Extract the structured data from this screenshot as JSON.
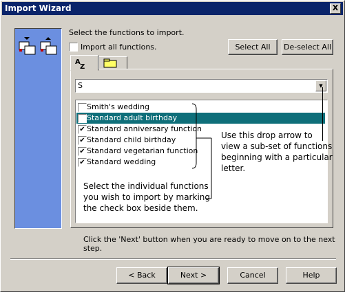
{
  "window": {
    "title": "Import Wizard",
    "close_glyph": "X"
  },
  "instruction": "Select the functions to import.",
  "import_all": {
    "label": "Import all functions.",
    "checked": false
  },
  "buttons": {
    "select_all": "Select All",
    "deselect_all": "De-select All",
    "back": "< Back",
    "next": "Next >",
    "cancel": "Cancel",
    "help": "Help"
  },
  "tabs": [
    {
      "label": "AZ",
      "icon": "sort-az-icon"
    },
    {
      "icon": "folder-icon"
    }
  ],
  "letter_filter": {
    "value": "S"
  },
  "functions": [
    {
      "label": "Smith's wedding",
      "checked": false,
      "selected": false
    },
    {
      "label": "Standard adult birthday",
      "checked": true,
      "selected": true
    },
    {
      "label": "Standard anniversary function",
      "checked": true,
      "selected": false
    },
    {
      "label": "Standard child birthday",
      "checked": true,
      "selected": false
    },
    {
      "label": "Standard vegetarian function",
      "checked": true,
      "selected": false
    },
    {
      "label": "Standard wedding",
      "checked": true,
      "selected": false
    }
  ],
  "callouts": {
    "drop_arrow": [
      "Use this drop arrow to",
      "view a sub-set of functions",
      "beginning with a particular",
      "letter."
    ],
    "select_functions": [
      "Select the individual functions",
      "you wish to import by marking",
      "the check box beside them."
    ]
  },
  "footer_note": "Click the 'Next' button when you are ready to move on to the next step.",
  "colors": {
    "title_bar": "#0a246a",
    "side_panel": "#6b8fe0",
    "selection": "#0f6f7a"
  }
}
